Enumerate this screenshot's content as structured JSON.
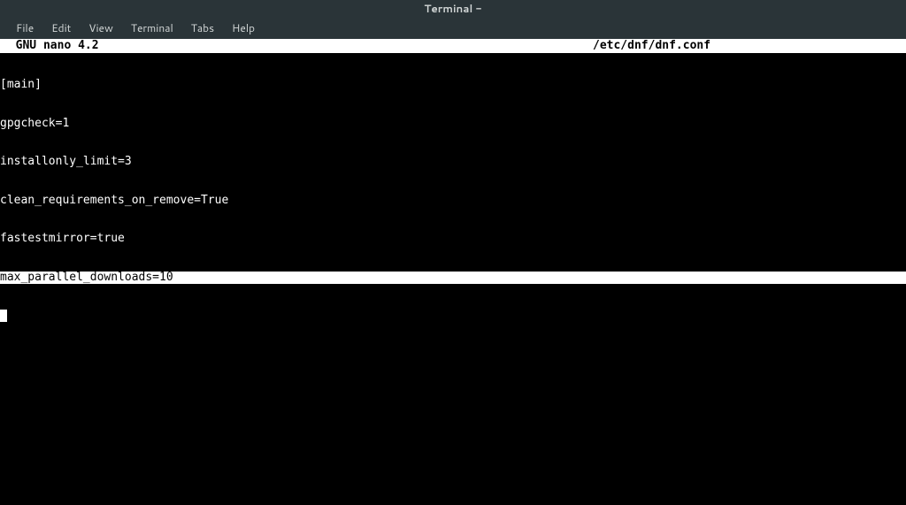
{
  "window": {
    "title": "Terminal -"
  },
  "menubar": {
    "items": [
      "File",
      "Edit",
      "View",
      "Terminal",
      "Tabs",
      "Help"
    ]
  },
  "nano": {
    "app_label": "  GNU nano 4.2",
    "file_path": "/etc/dnf/dnf.conf"
  },
  "file_lines": [
    "[main]",
    "gpgcheck=1",
    "installonly_limit=3",
    "clean_requirements_on_remove=True",
    "fastestmirror=true",
    "max_parallel_downloads=10"
  ]
}
